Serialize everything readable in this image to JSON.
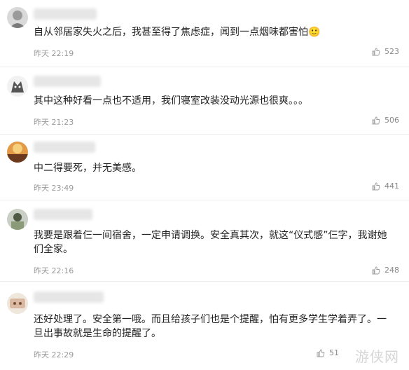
{
  "comments": [
    {
      "username": "",
      "text": "自从邻居家失火之后，我甚至得了焦虑症，闻到一点烟味都害怕🙂",
      "time": "昨天 22:19",
      "likes": "523"
    },
    {
      "username": "",
      "text": "其中这种好看一点也不适用，我们寝室改装没动光源也很爽。。。",
      "time": "昨天 21:23",
      "likes": "506"
    },
    {
      "username": "",
      "text": "中二得要死，并无美感。",
      "time": "昨天 23:49",
      "likes": "441"
    },
    {
      "username": "",
      "text": "我要是跟着仨一间宿舍，一定申请调换。安全真其次，就这“仪式感”仨字，我谢她们全家。",
      "time": "昨天 22:16",
      "likes": "248"
    },
    {
      "username": "",
      "text": "还好处理了。安全第一哦。而且给孩子们也是个提醒，怕有更多学生学着弄了。一旦出事故就是生命的提醒了。",
      "time": "昨天 22:29",
      "likes": "51"
    }
  ],
  "watermark": "游侠网",
  "colors": {
    "text": "#222222",
    "meta": "#999999",
    "divider": "#ececec"
  },
  "icons": [
    "avatar",
    "thumbs-up-icon"
  ]
}
